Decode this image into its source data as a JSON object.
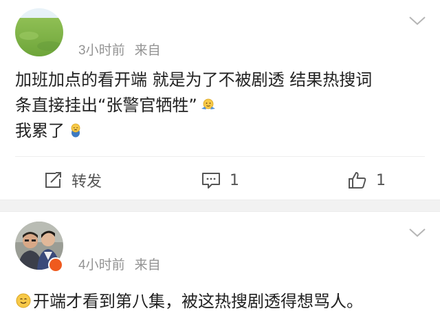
{
  "posts": [
    {
      "time": "3小时前",
      "source": "来自",
      "content_lines": [
        "加班加点的看开端 就是为了不被剧透 结果热搜词",
        "条直接挂出“张警官牺牲”",
        "我累了"
      ],
      "emojis": [
        "shrug-emoji",
        "tired-emoji"
      ],
      "actions": {
        "repost_label": "转发",
        "comment_count": "1",
        "like_count": "1"
      }
    },
    {
      "time": "4小时前",
      "source": "来自",
      "content_lines": [
        "开端才看到第八集，被这热搜剧透得想骂人。"
      ],
      "emojis": [
        "smile-emoji"
      ]
    }
  ],
  "colors": {
    "meta_text": "#939393",
    "body_text": "#222222",
    "separator": "#f2f2f2",
    "verified_badge": "#ef5a1e"
  }
}
